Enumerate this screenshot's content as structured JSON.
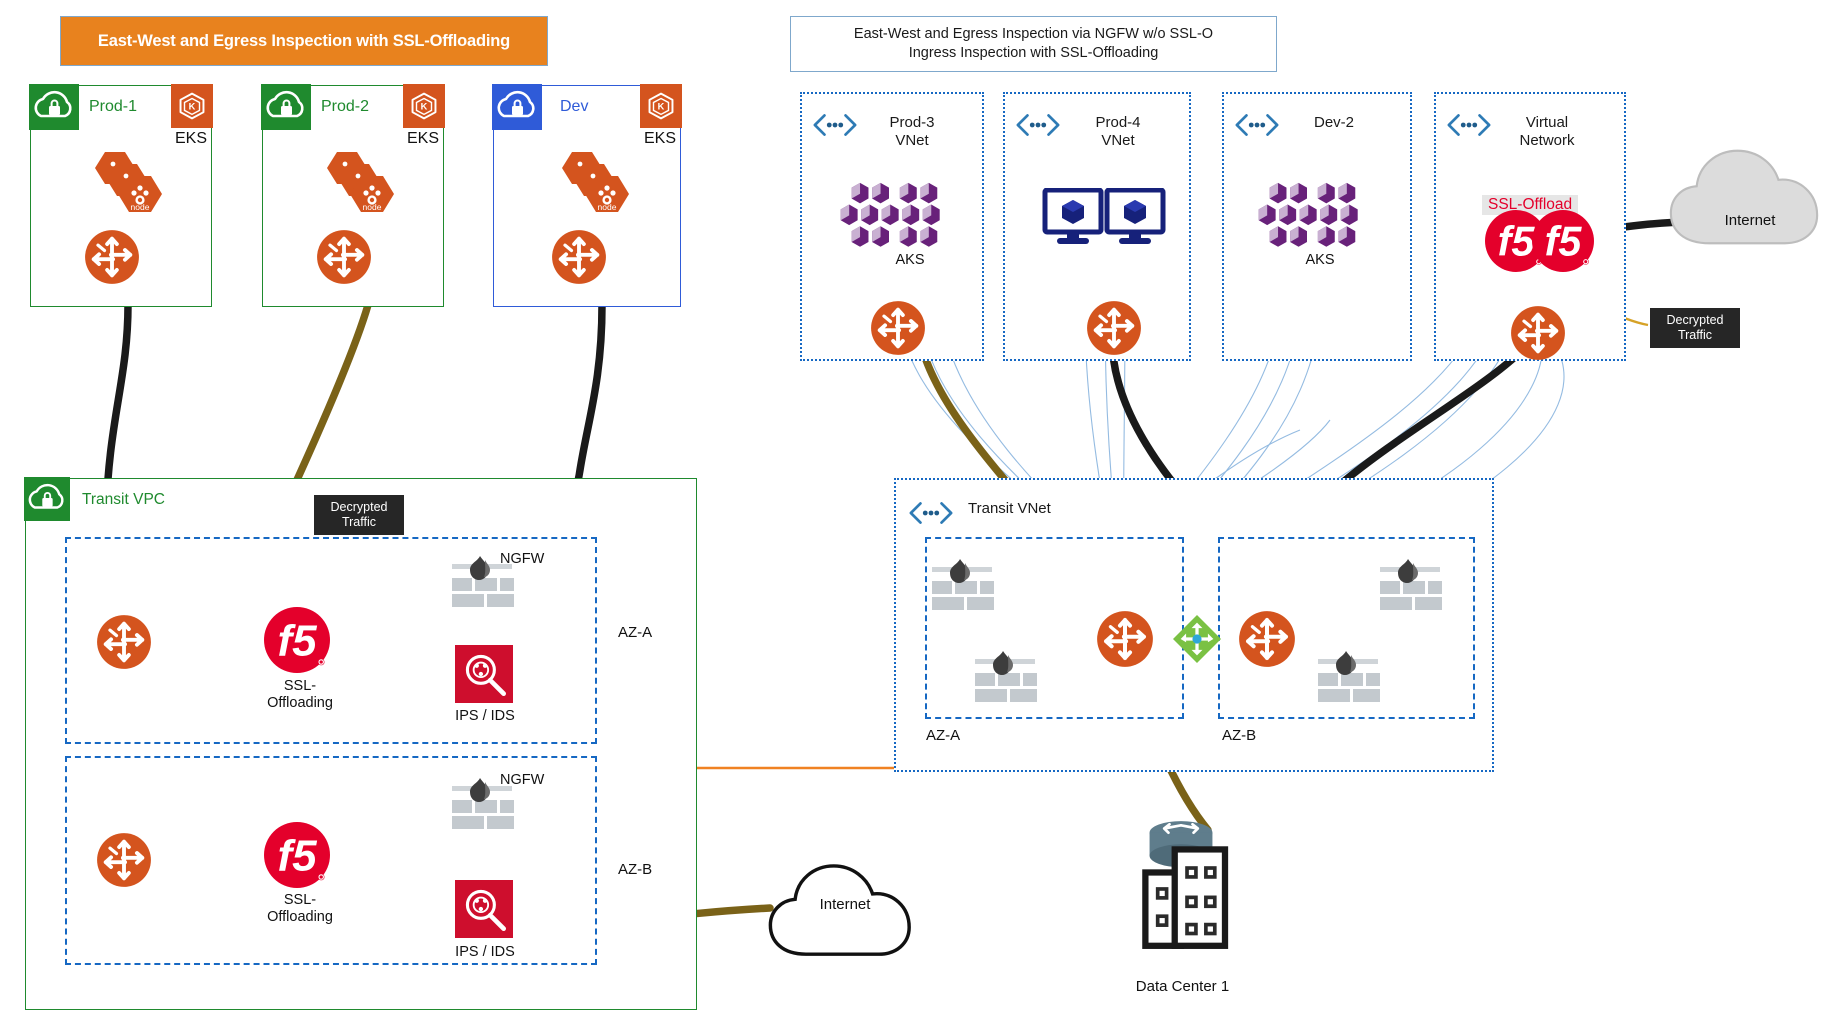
{
  "banners": {
    "left": "East-West and Egress Inspection with SSL-Offloading",
    "right_line1": "East-West and Egress Inspection via NGFW w/o SSL-O",
    "right_line2": "Ingress Inspection with SSL-Offloading"
  },
  "aws": {
    "vpcs": [
      {
        "name": "Prod-1",
        "platform": "EKS",
        "accent": "#1F8A2E",
        "cloud_icon": "secure-cloud-icon",
        "workload_icon": "eks-node-icon",
        "node_label": "node"
      },
      {
        "name": "Prod-2",
        "platform": "EKS",
        "accent": "#1F8A2E",
        "cloud_icon": "secure-cloud-icon",
        "workload_icon": "eks-node-icon",
        "node_label": "node"
      },
      {
        "name": "Dev",
        "platform": "EKS",
        "accent": "#2F5BD8",
        "cloud_icon": "secure-cloud-icon",
        "workload_icon": "eks-node-icon",
        "node_label": "node"
      }
    ],
    "transit": {
      "title": "Transit VPC",
      "decrypted_callout": "Decrypted\nTraffic",
      "decrypted_callout_l1": "Decrypted",
      "decrypted_callout_l2": "Traffic",
      "zones": [
        {
          "label": "AZ-A",
          "f5_label_l1": "SSL-",
          "f5_label_l2": "Offloading",
          "ngfw_label": "NGFW",
          "ips_label": "IPS / IDS"
        },
        {
          "label": "AZ-B",
          "f5_label_l1": "SSL-",
          "f5_label_l2": "Offloading",
          "ngfw_label": "NGFW",
          "ips_label": "IPS / IDS"
        }
      ]
    },
    "internet": "Internet"
  },
  "azure": {
    "vnets": [
      {
        "name_l1": "Prod-3",
        "name_l2": "VNet",
        "workload": "AKS",
        "workload_icon": "aks-hex-cluster-icon"
      },
      {
        "name_l1": "Prod-4",
        "name_l2": "VNet",
        "workload": "",
        "workload_icon": "vm-monitor-icon"
      },
      {
        "name_l1": "Dev-2",
        "name_l2": "",
        "workload": "AKS",
        "workload_icon": "aks-hex-cluster-icon"
      },
      {
        "name_l1": "Virtual",
        "name_l2": "Network",
        "workload": "",
        "workload_icon": "f5-logo-icon",
        "tag": "SSL-Offload"
      }
    ],
    "transit": {
      "title": "Transit VNet",
      "zones": [
        {
          "label": "AZ-A",
          "ngfw_count": 2
        },
        {
          "label": "AZ-B",
          "ngfw_count": 2
        }
      ]
    },
    "decrypted_callout_l1": "Decrypted",
    "decrypted_callout_l2": "Traffic",
    "internet": "Internet",
    "datacenter": "Data Center 1"
  },
  "colors": {
    "orange_banner": "#E8821E",
    "aws_green": "#1F8A2E",
    "aws_blue": "#2F5BD8",
    "azure_blue": "#1668C3",
    "f5_red": "#E4002B",
    "router_orange": "#D4541E",
    "ngfw_gray": "#C3C9CE",
    "ips_red": "#CE0E2D",
    "encrypted_black": "#1A1A1A",
    "decrypted_olive": "#7A6218",
    "orange_link": "#F08222",
    "aks_purple": "#68217A",
    "peering_green": "#7AC143"
  }
}
